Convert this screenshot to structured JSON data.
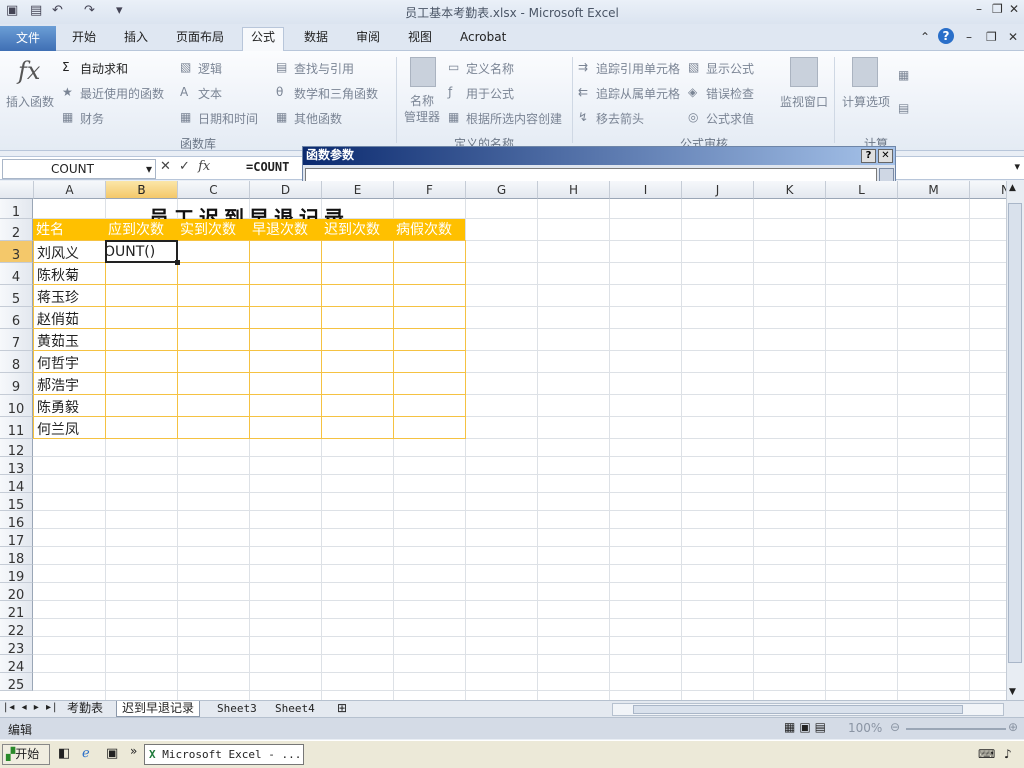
{
  "window": {
    "title": "员工基本考勤表.xlsx - Microsoft Excel"
  },
  "ribbon_tabs": [
    "文件",
    "开始",
    "插入",
    "页面布局",
    "公式",
    "数据",
    "审阅",
    "视图",
    "Acrobat"
  ],
  "ribbon": {
    "insert_function": "插入函数",
    "autosum": "自动求和",
    "recent": "最近使用的函数",
    "finance": "财务",
    "logic": "逻辑",
    "text": "文本",
    "datetime": "日期和时间",
    "lookup": "查找与引用",
    "math": "数学和三角函数",
    "other": "其他函数",
    "group_library": "函数库",
    "name_manager": "名称\n管理器",
    "define_name": "定义名称",
    "use_in_formula": "用于公式",
    "create_from_selection": "根据所选内容创建",
    "group_names": "定义的名称",
    "trace_precedents": "追踪引用单元格",
    "trace_dependents": "追踪从属单元格",
    "remove_arrows": "移去箭头",
    "show_formulas": "显示公式",
    "error_checking": "错误检查",
    "evaluate_formula": "公式求值",
    "group_audit": "公式审核",
    "watch_window": "监视窗口",
    "calc_options": "计算选项",
    "group_calc": "计算"
  },
  "namebox": "COUNT",
  "formula": "=COUNT",
  "dialog": {
    "title": "函数参数"
  },
  "columns": [
    "A",
    "B",
    "C",
    "D",
    "E",
    "F",
    "G",
    "H",
    "I",
    "J",
    "K",
    "L",
    "M",
    "N"
  ],
  "rows": [
    "1",
    "2",
    "3",
    "4",
    "5",
    "6",
    "7",
    "8",
    "9",
    "10",
    "11",
    "12",
    "13",
    "14",
    "15",
    "16",
    "17",
    "18",
    "19",
    "20",
    "21",
    "22",
    "23",
    "24",
    "25"
  ],
  "sheet": {
    "title": "员工迟到早退记录",
    "headers": [
      "姓名",
      "应到次数",
      "实到次数",
      "早退次数",
      "迟到次数",
      "病假次数"
    ],
    "names": [
      "刘风义",
      "陈秋菊",
      "蒋玉珍",
      "赵俏茹",
      "黄茹玉",
      "何哲宇",
      "郝浩宇",
      "陈勇毅",
      "何兰凤"
    ],
    "active_cell_text": "OUNT()"
  },
  "sheet_tabs": [
    "考勤表",
    "迟到早退记录",
    "Sheet3",
    "Sheet4"
  ],
  "status": {
    "mode": "编辑",
    "zoom": "100%"
  },
  "taskbar": {
    "start": "开始",
    "item": "Microsoft Excel - ..."
  }
}
